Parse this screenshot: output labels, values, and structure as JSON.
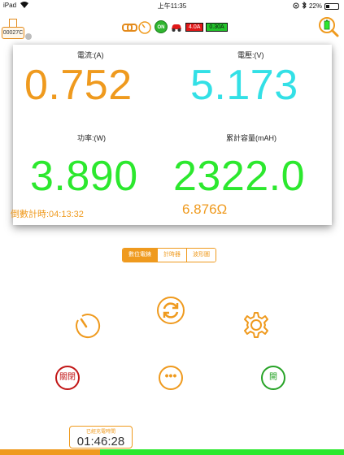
{
  "status": {
    "device": "iPad",
    "time": "上午11:35",
    "battery": "22%"
  },
  "header": {
    "device_id": "00027C",
    "on_label": "ON",
    "current_limit": "4.0A",
    "current_min": "0.30A"
  },
  "readings": {
    "current_label": "電流:(A)",
    "current_value": "0.752",
    "voltage_label": "電壓:(V)",
    "voltage_value": "5.173",
    "power_label": "功率:(W)",
    "power_value": "3.890",
    "capacity_label": "累計容量(mAH)",
    "capacity_value": "2322.0",
    "countdown": "倒數計時:04:13:32",
    "resistance": "6.876Ω"
  },
  "tabs": [
    "數位電錶",
    "計時器",
    "波形圖"
  ],
  "actions": {
    "off_label": "關閉",
    "more_label": "•••",
    "on_label": "開"
  },
  "footer": {
    "charge_label": "已經充電時間",
    "charge_time": "01:46:28",
    "progress": 0.29
  },
  "colors": {
    "accent": "#ef9a1e",
    "voltage": "#33e0e6",
    "power": "#2ce82e",
    "off": "#c21717",
    "on": "#27a327"
  }
}
